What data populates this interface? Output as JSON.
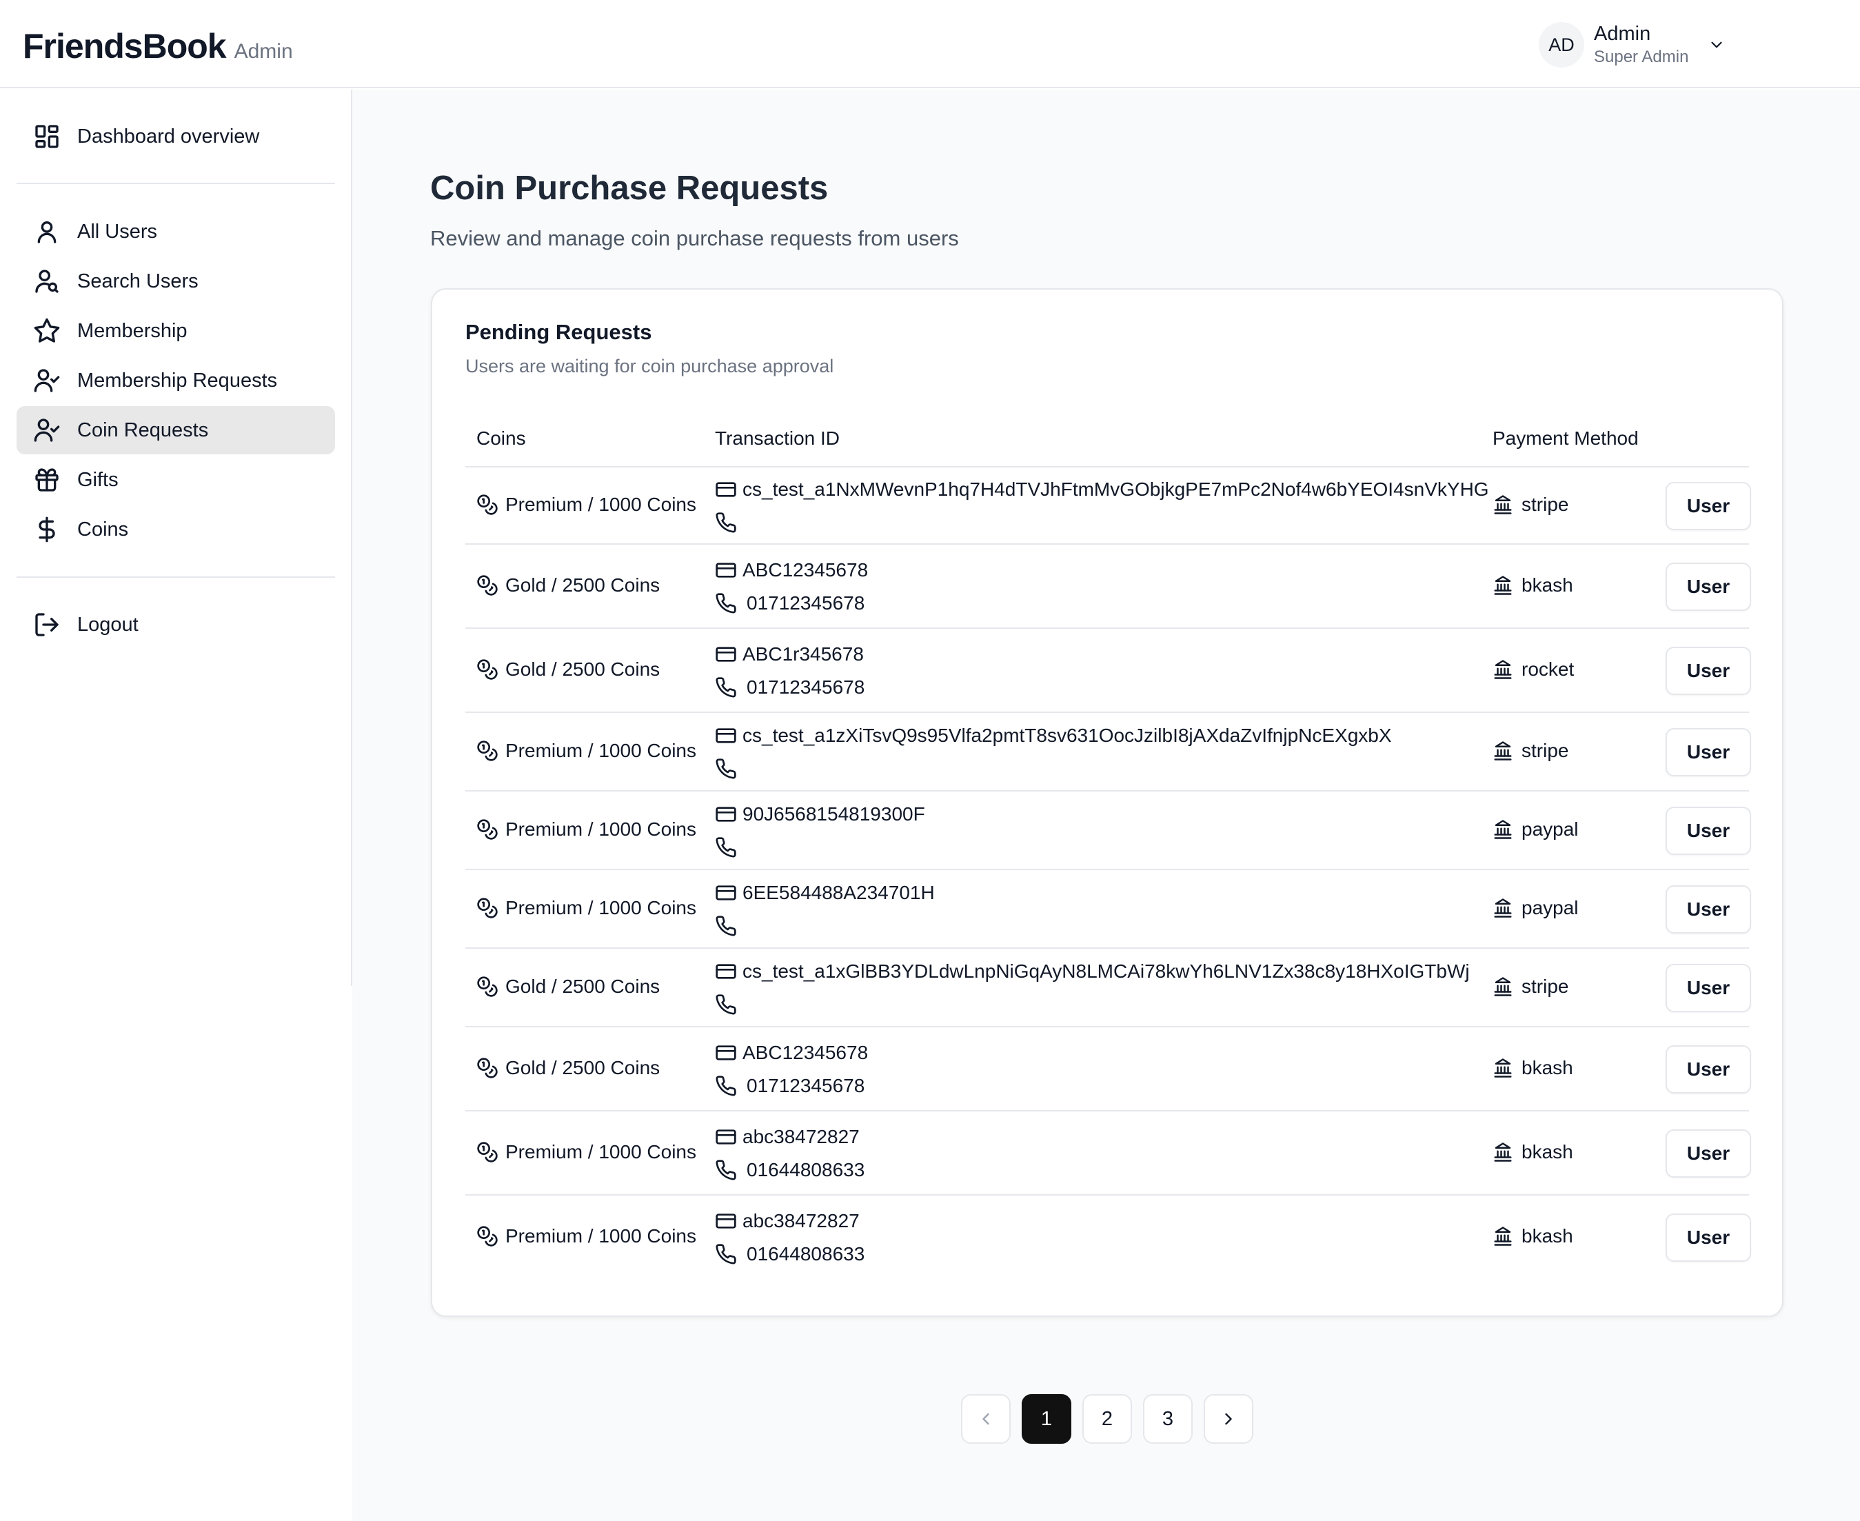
{
  "header": {
    "brand_name": "FriendsBook",
    "brand_sub": "Admin",
    "avatar_initials": "AD",
    "user_name": "Admin",
    "user_role": "Super Admin"
  },
  "sidebar": {
    "items": [
      {
        "label": "Dashboard overview",
        "icon": "dashboard-icon"
      },
      {
        "label": "All Users",
        "icon": "user-icon"
      },
      {
        "label": "Search Users",
        "icon": "user-search-icon"
      },
      {
        "label": "Membership",
        "icon": "star-icon"
      },
      {
        "label": "Membership Requests",
        "icon": "user-check-icon"
      },
      {
        "label": "Coin Requests",
        "icon": "user-check-icon",
        "active": true
      },
      {
        "label": "Gifts",
        "icon": "gift-icon"
      },
      {
        "label": "Coins",
        "icon": "dollar-icon"
      },
      {
        "label": "Logout",
        "icon": "logout-icon"
      }
    ]
  },
  "page": {
    "title": "Coin Purchase Requests",
    "subtitle": "Review and manage coin purchase requests from users"
  },
  "card": {
    "title": "Pending Requests",
    "subtitle": "Users are waiting for coin purchase approval",
    "columns": [
      "Coins",
      "Transaction ID",
      "Payment Method"
    ],
    "action_label": "User",
    "rows": [
      {
        "coins": "Premium / 1000 Coins",
        "tx": "cs_test_a1NxMWevnP1hq7H4dTVJhFtmMvGObjkgPE7mPc2Nof4w6bYEOI4snVkYHG",
        "phone": "",
        "method": "stripe"
      },
      {
        "coins": "Gold / 2500 Coins",
        "tx": "ABC12345678",
        "phone": "01712345678",
        "method": "bkash"
      },
      {
        "coins": "Gold / 2500 Coins",
        "tx": "ABC1r345678",
        "phone": "01712345678",
        "method": "rocket"
      },
      {
        "coins": "Premium / 1000 Coins",
        "tx": "cs_test_a1zXiTsvQ9s95Vlfa2pmtT8sv631OocJzilbI8jAXdaZvIfnjpNcEXgxbX",
        "phone": "",
        "method": "stripe"
      },
      {
        "coins": "Premium / 1000 Coins",
        "tx": "90J6568154819300F",
        "phone": "",
        "method": "paypal"
      },
      {
        "coins": "Premium / 1000 Coins",
        "tx": "6EE584488A234701H",
        "phone": "",
        "method": "paypal"
      },
      {
        "coins": "Gold / 2500 Coins",
        "tx": "cs_test_a1xGlBB3YDLdwLnpNiGqAyN8LMCAi78kwYh6LNV1Zx38c8y18HXoIGTbWj",
        "phone": "",
        "method": "stripe"
      },
      {
        "coins": "Gold / 2500 Coins",
        "tx": "ABC12345678",
        "phone": "01712345678",
        "method": "bkash"
      },
      {
        "coins": "Premium / 1000 Coins",
        "tx": "abc38472827",
        "phone": "01644808633",
        "method": "bkash"
      },
      {
        "coins": "Premium / 1000 Coins",
        "tx": "abc38472827",
        "phone": "01644808633",
        "method": "bkash"
      }
    ]
  },
  "pagination": {
    "pages": [
      "1",
      "2",
      "3"
    ],
    "current": "1"
  }
}
